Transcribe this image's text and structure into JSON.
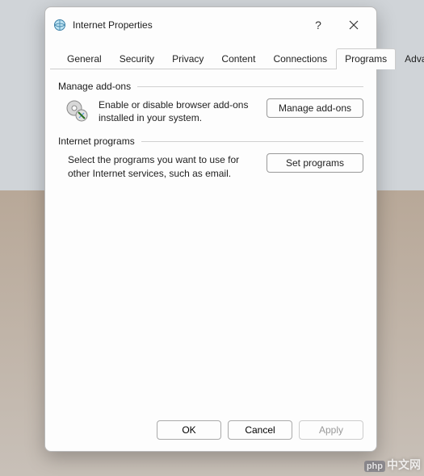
{
  "window": {
    "title": "Internet Properties"
  },
  "tabs": [
    {
      "label": "General",
      "active": false
    },
    {
      "label": "Security",
      "active": false
    },
    {
      "label": "Privacy",
      "active": false
    },
    {
      "label": "Content",
      "active": false
    },
    {
      "label": "Connections",
      "active": false
    },
    {
      "label": "Programs",
      "active": true
    },
    {
      "label": "Advanced",
      "active": false
    }
  ],
  "groups": {
    "addons": {
      "title": "Manage add-ons",
      "desc": "Enable or disable browser add-ons installed in your system.",
      "button": "Manage add-ons"
    },
    "programs": {
      "title": "Internet programs",
      "desc": "Select the programs you want to use for other Internet services, such as email.",
      "button": "Set programs"
    }
  },
  "footer": {
    "ok": "OK",
    "cancel": "Cancel",
    "apply": "Apply"
  },
  "watermark": "中文网"
}
